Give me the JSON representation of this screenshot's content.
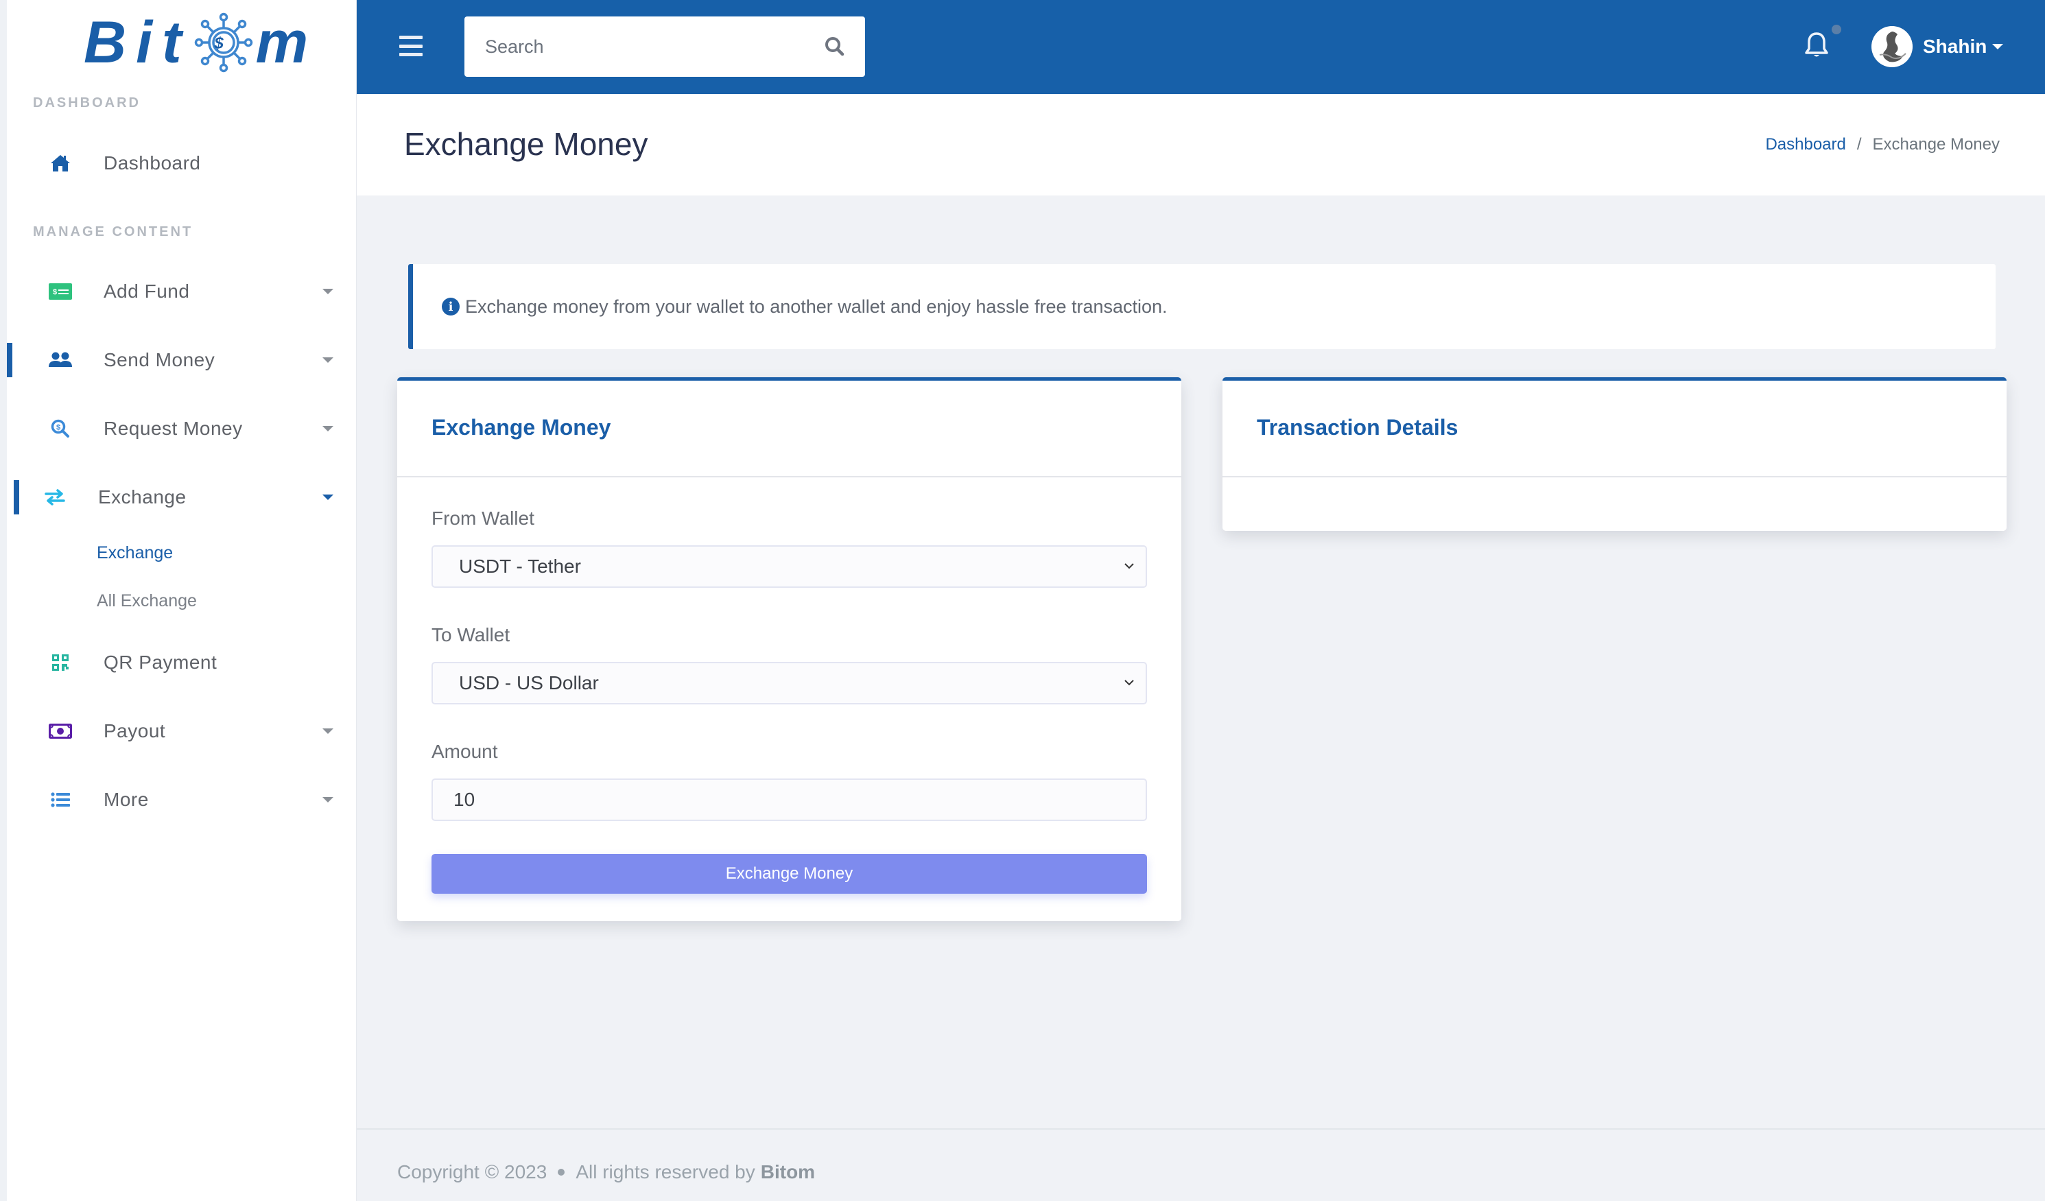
{
  "brand": {
    "name": "Bitom",
    "logo_letters_before": "Bit",
    "logo_letters_after": "m",
    "primary_color": "#1a5ea8"
  },
  "sidebar": {
    "sections": [
      {
        "label": "Dashboard"
      },
      {
        "label": "Manage Content"
      }
    ],
    "items": [
      {
        "label": "Dashboard",
        "icon": "home-icon",
        "has_caret": false
      },
      {
        "label": "Add Fund",
        "icon": "money-check-icon",
        "has_caret": true
      },
      {
        "label": "Send Money",
        "icon": "users-icon",
        "has_caret": true
      },
      {
        "label": "Request Money",
        "icon": "search-dollar-icon",
        "has_caret": true
      },
      {
        "label": "Exchange",
        "icon": "exchange-arrows-icon",
        "has_caret": true,
        "expanded": true,
        "children": [
          {
            "label": "Exchange",
            "active": true
          },
          {
            "label": "All Exchange",
            "active": false
          }
        ]
      },
      {
        "label": "QR Payment",
        "icon": "qrcode-icon",
        "has_caret": false
      },
      {
        "label": "Payout",
        "icon": "money-bill-icon",
        "has_caret": true
      },
      {
        "label": "More",
        "icon": "list-icon",
        "has_caret": true
      }
    ]
  },
  "header": {
    "search_placeholder": "Search",
    "search_value": "",
    "user_name": "Shahin"
  },
  "page": {
    "title": "Exchange Money",
    "breadcrumb": [
      {
        "label": "Dashboard",
        "link": true
      },
      {
        "label": "Exchange Money",
        "link": false
      }
    ],
    "breadcrumb_separator": "/"
  },
  "alert": {
    "icon": "info-circle-icon",
    "text": "Exchange money from your wallet to another wallet and enjoy hassle free transaction."
  },
  "exchange_form": {
    "title": "Exchange Money",
    "from_wallet": {
      "label": "From Wallet",
      "selected": "USDT - Tether"
    },
    "to_wallet": {
      "label": "To Wallet",
      "selected": "USD - US Dollar"
    },
    "amount": {
      "label": "Amount",
      "value": "10"
    },
    "submit_label": "Exchange Money",
    "submit_color": "#7e8bee"
  },
  "transaction_details": {
    "title": "Transaction Details"
  },
  "footer": {
    "copyright": "Copyright © 2023",
    "rights": "All rights reserved by",
    "brand": "Bitom"
  }
}
